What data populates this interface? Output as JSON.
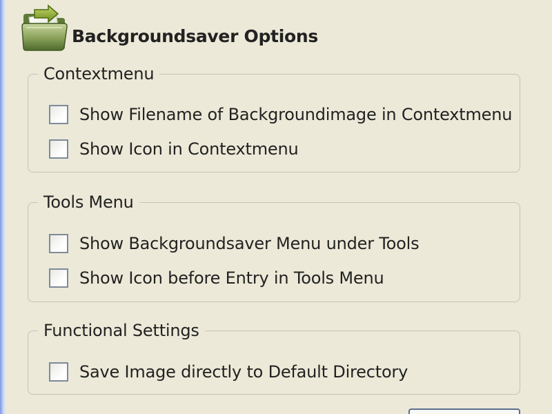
{
  "dialog": {
    "title": "Backgroundsaver Options",
    "header_icon": "folder-with-arrow-icon"
  },
  "groups": [
    {
      "legend": "Contextmenu",
      "options": [
        {
          "label": "Show Filename of Backgroundimage in Contextmenu",
          "checked": false
        },
        {
          "label": "Show Icon in Contextmenu",
          "checked": false
        }
      ]
    },
    {
      "legend": "Tools Menu",
      "options": [
        {
          "label": "Show Backgroundsaver Menu under Tools",
          "checked": false
        },
        {
          "label": "Show Icon before Entry in Tools Menu",
          "checked": false
        }
      ]
    },
    {
      "legend": "Functional Settings",
      "options": [
        {
          "label": "Save Image directly to Default Directory",
          "checked": false
        }
      ]
    }
  ]
}
